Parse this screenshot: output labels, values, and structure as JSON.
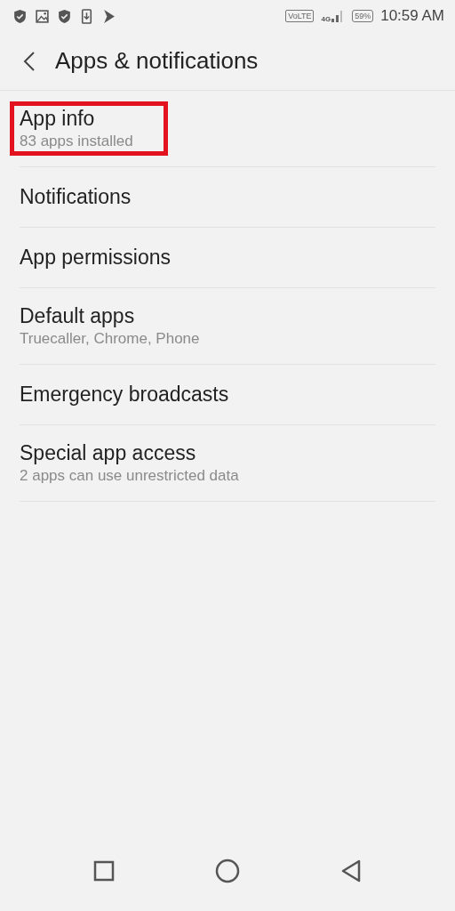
{
  "status_bar": {
    "volte": "VoLTE",
    "network": "4G",
    "battery": "59%",
    "time": "10:59 AM"
  },
  "header": {
    "title": "Apps & notifications"
  },
  "items": [
    {
      "title": "App info",
      "subtitle": "83 apps installed",
      "highlighted": true
    },
    {
      "title": "Notifications",
      "highlighted": false
    },
    {
      "title": "App permissions",
      "highlighted": false
    },
    {
      "title": "Default apps",
      "subtitle": "Truecaller, Chrome, Phone",
      "highlighted": false
    },
    {
      "title": "Emergency broadcasts",
      "highlighted": false
    },
    {
      "title": "Special app access",
      "subtitle": "2 apps can use unrestricted data",
      "highlighted": false
    }
  ]
}
